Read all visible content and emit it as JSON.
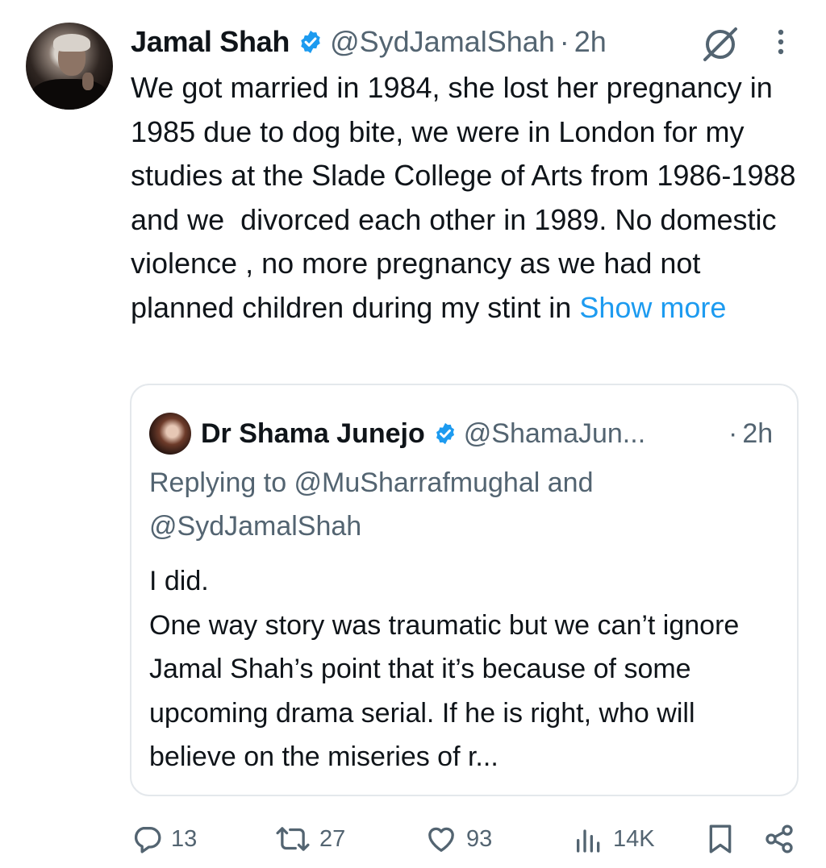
{
  "tweet": {
    "author_name": "Jamal Shah",
    "handle": "@SydJamalShah",
    "separator": "·",
    "time": "2h",
    "text": "We got married in 1984, she lost her pregnancy in 1985 due to dog bite, we were in London for my studies at the Slade College of Arts from 1986-1988 and we  divorced each other in 1989. No domestic violence , no more pregnancy as we had not planned children during my stint in ",
    "show_more": "Show more"
  },
  "quote": {
    "author_name": "Dr Shama Junejo",
    "handle": "@ShamaJun...",
    "separator": "·",
    "time": "2h",
    "replying": "Replying to @MuSharrafmughal and @SydJamalShah",
    "text": "I did.\nOne way story was traumatic but we can’t ignore Jamal Shah’s point that it’s because of some upcoming drama serial. If he is right, who will believe on the miseries of r..."
  },
  "actions": {
    "replies": "13",
    "retweets": "27",
    "likes": "93",
    "views": "14K"
  },
  "colors": {
    "verified": "#1d9bf0",
    "link": "#1d9bf0",
    "muted": "#536471",
    "text": "#0f1419",
    "border": "#e4e8ec"
  },
  "icons": {
    "verified": "verified-badge-icon",
    "grok": "grok-icon",
    "more": "more-vertical-icon",
    "reply": "reply-icon",
    "retweet": "retweet-icon",
    "like": "heart-icon",
    "views": "views-icon",
    "bookmark": "bookmark-icon",
    "share": "share-icon"
  }
}
